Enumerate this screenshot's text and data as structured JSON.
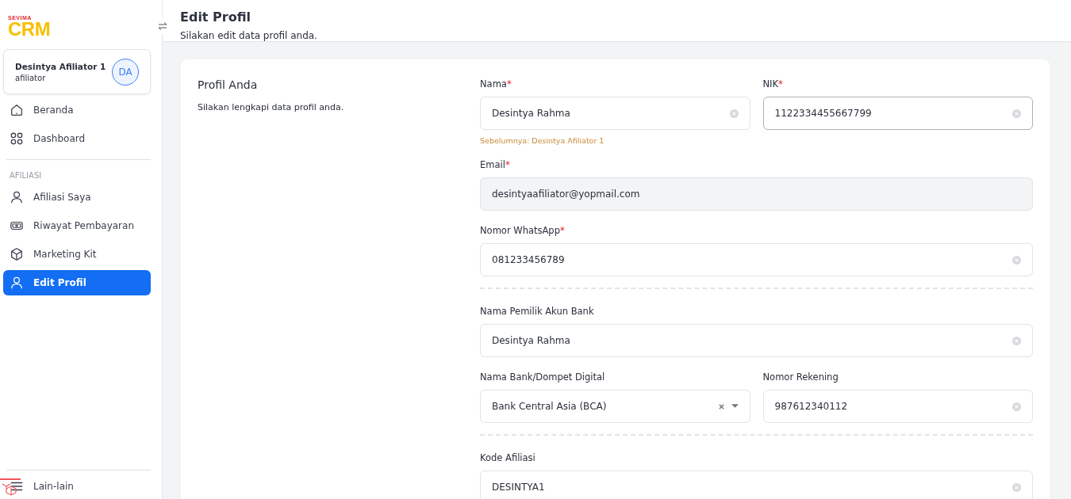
{
  "brand": {
    "top": "SEVIMA",
    "main": "CRM"
  },
  "user": {
    "name": "Desintya Afiliator 1",
    "role": "afiliator",
    "initials": "DA"
  },
  "nav": [
    {
      "label": "Beranda",
      "kind": "home",
      "selected": false
    },
    {
      "label": "Dashboard",
      "kind": "grid",
      "selected": false
    }
  ],
  "nav_section": {
    "title": "AFILIASI",
    "items": [
      {
        "label": "Afiliasi Saya",
        "kind": "user",
        "selected": false
      },
      {
        "label": "Riwayat Pembayaran",
        "kind": "money",
        "selected": false
      },
      {
        "label": "Marketing Kit",
        "kind": "box",
        "selected": false
      },
      {
        "label": "Edit Profil",
        "kind": "user",
        "selected": true
      }
    ]
  },
  "footer_nav": {
    "label": "Lain-lain"
  },
  "header": {
    "title": "Edit Profil",
    "subtitle": "Silakan edit data profil anda."
  },
  "card": {
    "title": "Profil Anda",
    "description": "Silakan lengkapi data profil anda."
  },
  "sections": [
    [
      [
        {
          "label": "Nama",
          "required_mark": "*",
          "kind": "text",
          "value": "Desintya Rahma",
          "focused": false,
          "hint": "Sebelumnya: Desintya Afiliator 1"
        },
        {
          "label": "NIK",
          "required_mark": "*",
          "kind": "text",
          "value": "1122334455667799",
          "focused": true
        }
      ],
      [
        {
          "label": "Email",
          "required_mark": "*",
          "kind": "disabled",
          "value": "desintyaafiliator@yopmail.com",
          "focused": false
        }
      ],
      [
        {
          "label": "Nomor WhatsApp",
          "required_mark": "*",
          "kind": "text",
          "value": "081233456789",
          "focused": false
        }
      ]
    ],
    [
      [
        {
          "label": "Nama Pemilik Akun Bank",
          "kind": "text",
          "value": "Desintya Rahma",
          "focused": false
        }
      ],
      [
        {
          "label": "Nama Bank/Dompet Digital",
          "kind": "select",
          "value": "Bank Central Asia (BCA)",
          "focused": false
        },
        {
          "label": "Nomor Rekening",
          "kind": "text",
          "value": "987612340112",
          "focused": false
        }
      ]
    ],
    [
      [
        {
          "label": "Kode Afiliasi",
          "kind": "text",
          "value": "DESINTYA1",
          "focused": false
        }
      ]
    ]
  ]
}
